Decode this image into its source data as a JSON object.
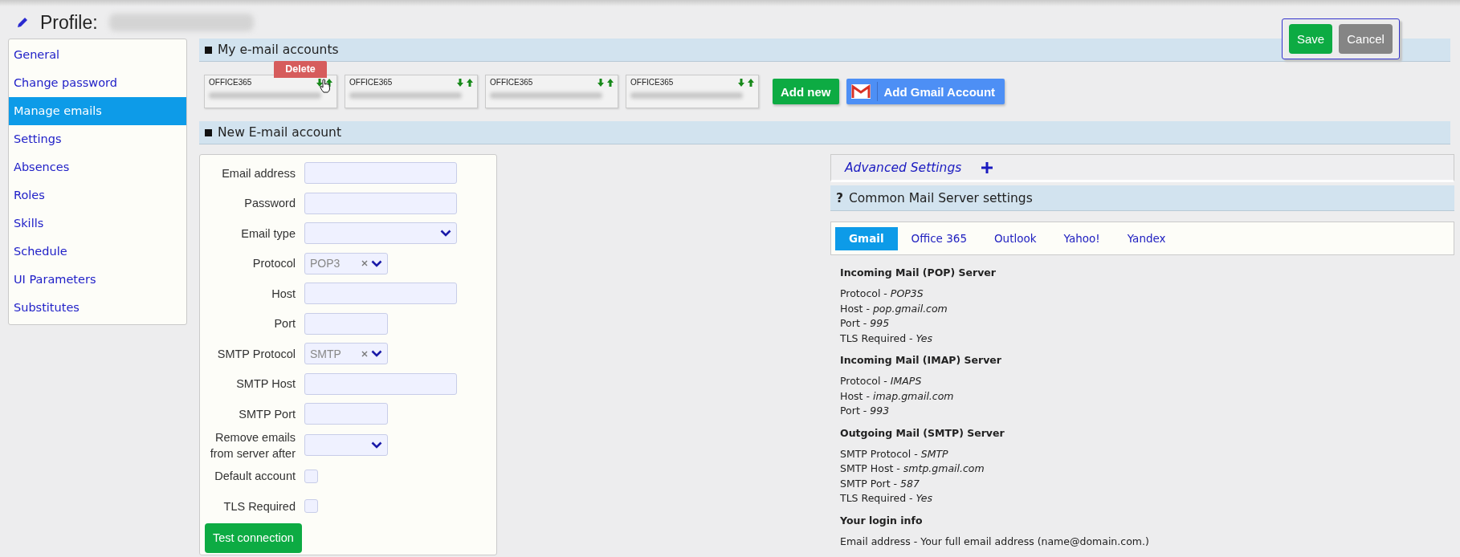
{
  "page_title": "Profile:",
  "actions": {
    "save": "Save",
    "cancel": "Cancel"
  },
  "sidebar": {
    "items": [
      {
        "label": "General",
        "selected": false
      },
      {
        "label": "Change password",
        "selected": false
      },
      {
        "label": "Manage emails",
        "selected": true
      },
      {
        "label": "Settings",
        "selected": false
      },
      {
        "label": "Absences",
        "selected": false
      },
      {
        "label": "Roles",
        "selected": false
      },
      {
        "label": "Skills",
        "selected": false
      },
      {
        "label": "Schedule",
        "selected": false
      },
      {
        "label": "UI Parameters",
        "selected": false
      },
      {
        "label": "Substitutes",
        "selected": false
      }
    ]
  },
  "accounts_section": {
    "title": "My e-mail accounts",
    "delete_tooltip": "Delete",
    "accounts": [
      {
        "type": "OFFICE365"
      },
      {
        "type": "OFFICE365"
      },
      {
        "type": "OFFICE365"
      },
      {
        "type": "OFFICE365"
      }
    ],
    "add_new": "Add new",
    "add_gmail": "Add Gmail Account"
  },
  "new_account": {
    "title": "New E-mail account",
    "fields": [
      {
        "label": "Email address",
        "kind": "text"
      },
      {
        "label": "Password",
        "kind": "text"
      },
      {
        "label": "Email type",
        "kind": "select"
      },
      {
        "label": "Protocol",
        "kind": "clearable-select",
        "value": "POP3"
      },
      {
        "label": "Host",
        "kind": "text"
      },
      {
        "label": "Port",
        "kind": "short-text"
      },
      {
        "label": "SMTP Protocol",
        "kind": "clearable-select",
        "value": "SMTP"
      },
      {
        "label": "SMTP Host",
        "kind": "text"
      },
      {
        "label": "SMTP Port",
        "kind": "short-text"
      },
      {
        "label": "Remove emails from server after",
        "kind": "short-select"
      },
      {
        "label": "Default account",
        "kind": "checkbox",
        "checked": false
      },
      {
        "label": "TLS Required",
        "kind": "checkbox",
        "checked": false
      }
    ],
    "test_button": "Test connection"
  },
  "advanced": {
    "label": "Advanced Settings",
    "expanded": false
  },
  "common": {
    "help_mark": "?",
    "title": "Common Mail Server settings",
    "tabs": [
      {
        "label": "Gmail",
        "selected": true
      },
      {
        "label": "Office 365",
        "selected": false
      },
      {
        "label": "Outlook",
        "selected": false
      },
      {
        "label": "Yahoo!",
        "selected": false
      },
      {
        "label": "Yandex",
        "selected": false
      }
    ],
    "sections": [
      {
        "heading": "Incoming Mail (POP) Server",
        "lines": [
          "Protocol - *POP3S*",
          "Host - *pop.gmail.com*",
          "Port - *995*",
          "TLS Required - *Yes*"
        ]
      },
      {
        "heading": "Incoming Mail (IMAP) Server",
        "lines": [
          "Protocol - *IMAPS*",
          "Host - *imap.gmail.com*",
          "Port - *993*"
        ]
      },
      {
        "heading": "Outgoing Mail (SMTP) Server",
        "lines": [
          "SMTP Protocol - *SMTP*",
          "SMTP Host - *smtp.gmail.com*",
          "SMTP Port - *587*",
          "TLS Required - *Yes*"
        ]
      },
      {
        "heading": "Your login info",
        "lines": [
          "Email address - Your full email address (name@domain.com.)"
        ]
      }
    ]
  }
}
